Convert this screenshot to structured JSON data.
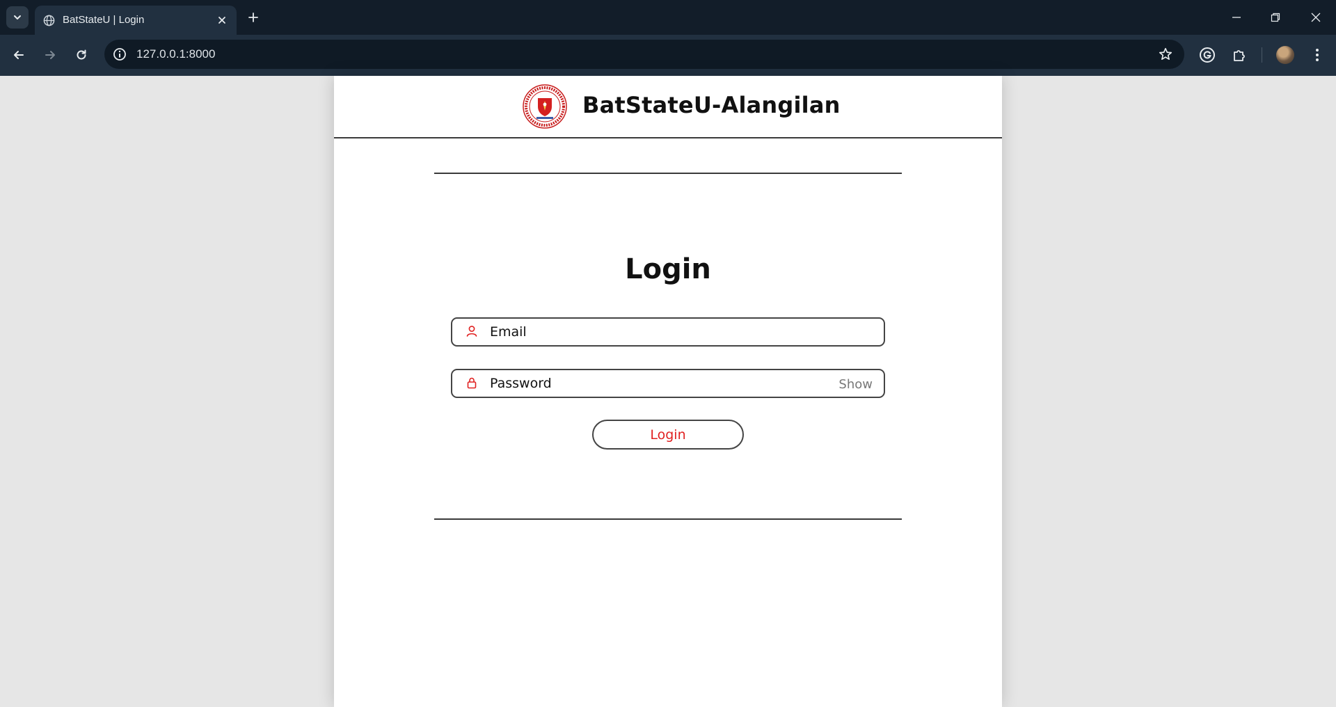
{
  "browser": {
    "tab_title": "BatStateU | Login",
    "url": "127.0.0.1:8000",
    "icons": {
      "tab_search": "chevron-down-icon",
      "favicon": "globe-icon",
      "tab_close": "close-icon",
      "new_tab": "plus-icon",
      "back": "back-arrow-icon",
      "forward": "forward-arrow-icon",
      "reload": "reload-icon",
      "site_info": "info-icon",
      "bookmark": "star-icon",
      "grammarly": "grammarly-icon",
      "extensions": "puzzle-icon",
      "menu": "kebab-menu-icon",
      "minimize": "minimize-icon",
      "restore": "restore-icon",
      "close_window": "close-icon"
    }
  },
  "header": {
    "title": "BatStateU-Alangilan",
    "logo": "university-seal"
  },
  "login": {
    "heading": "Login",
    "email_placeholder": "Email",
    "password_placeholder": "Password",
    "show_label": "Show",
    "submit_label": "Login"
  },
  "colors": {
    "accent": "#e02020",
    "border": "#444444",
    "chrome_dark": "#121d29",
    "chrome_toolbar": "#213040",
    "page_bg": "#e6e6e6"
  }
}
